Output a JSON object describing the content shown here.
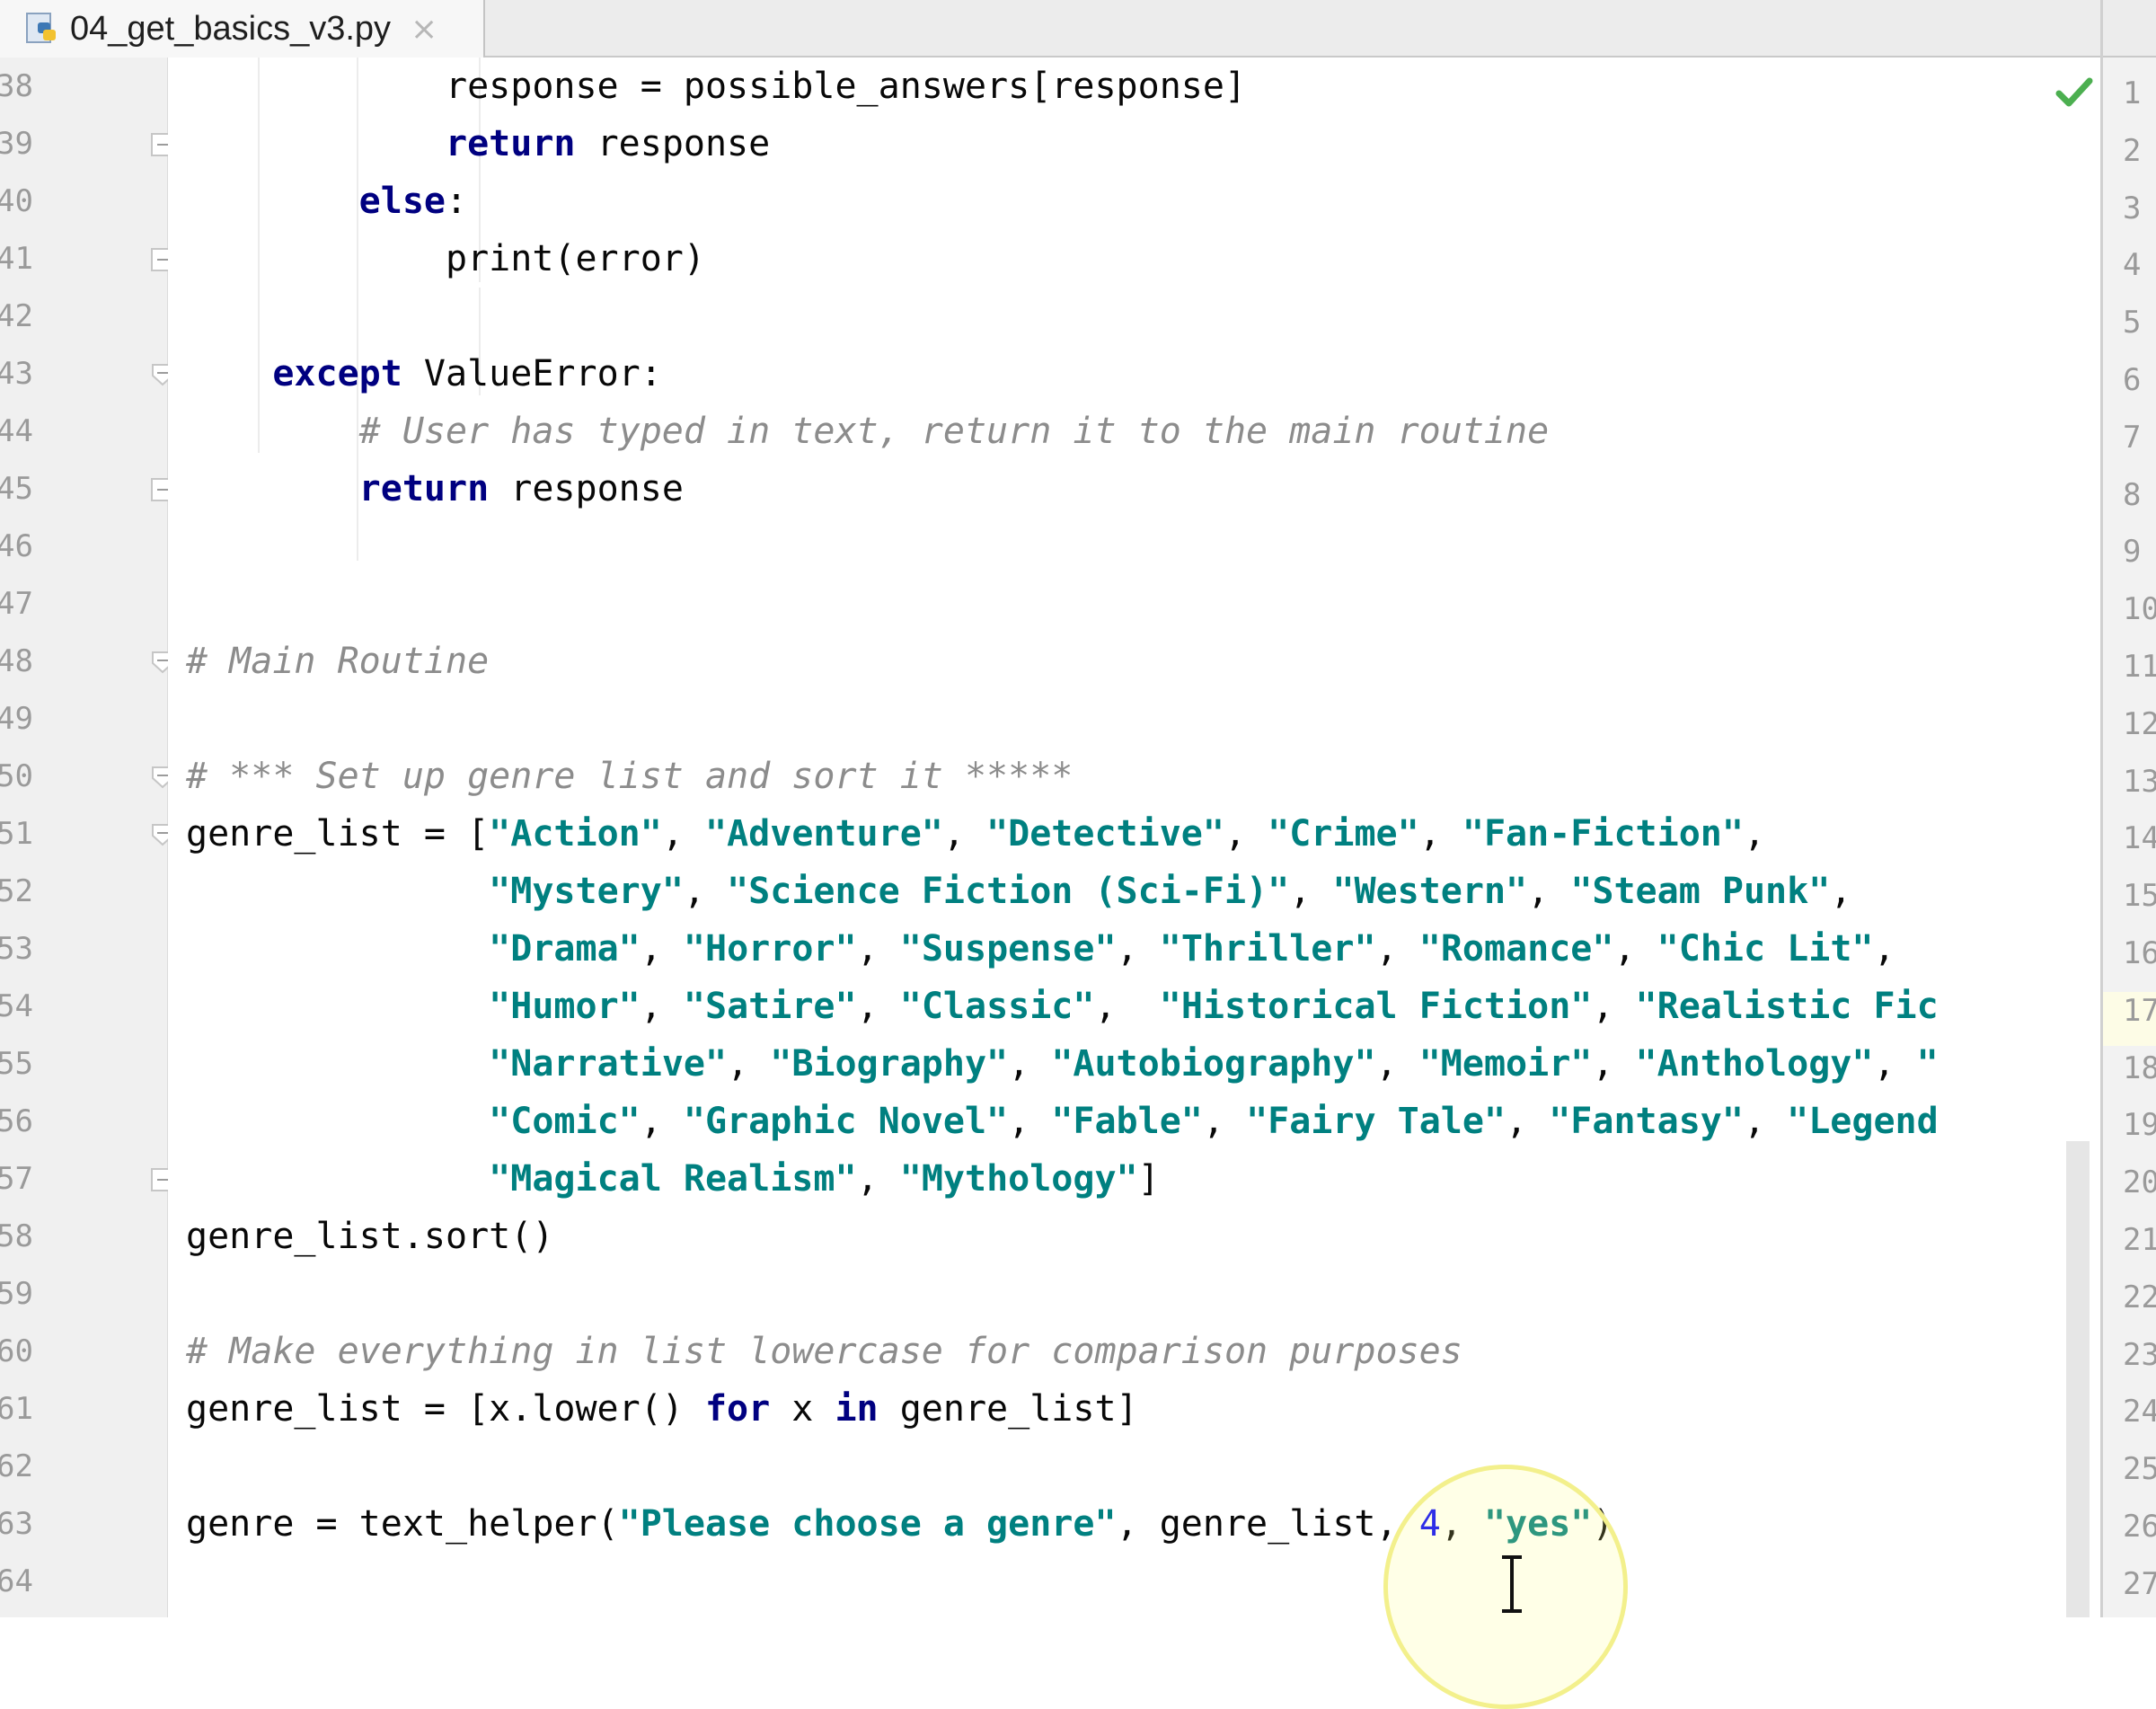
{
  "tab": {
    "filename": "04_get_basics_v3.py",
    "close_glyph": "×",
    "icon": "python-file-icon"
  },
  "status": {
    "inspection_icon": "check-icon",
    "inspection_color": "#4caf50"
  },
  "colors": {
    "keyword": "#000080",
    "string": "#008080",
    "comment": "#8c8c8c",
    "number": "#0000ff",
    "plain": "#080808"
  },
  "lines": [
    {
      "num": "38",
      "segments": [
        {
          "t": "            response = possible_answers[response]",
          "k": "plain"
        }
      ]
    },
    {
      "num": "39",
      "segments": [
        {
          "t": "            ",
          "k": "plain"
        },
        {
          "t": "return",
          "k": "kw"
        },
        {
          "t": " response",
          "k": "plain"
        }
      ]
    },
    {
      "num": "40",
      "segments": [
        {
          "t": "        ",
          "k": "plain"
        },
        {
          "t": "else",
          "k": "kw"
        },
        {
          "t": ":",
          "k": "plain"
        }
      ]
    },
    {
      "num": "41",
      "segments": [
        {
          "t": "            print(error)",
          "k": "plain"
        }
      ]
    },
    {
      "num": "42",
      "segments": []
    },
    {
      "num": "43",
      "segments": [
        {
          "t": "    ",
          "k": "plain"
        },
        {
          "t": "except",
          "k": "kw"
        },
        {
          "t": " ValueError:",
          "k": "plain"
        }
      ]
    },
    {
      "num": "44",
      "segments": [
        {
          "t": "        ",
          "k": "plain"
        },
        {
          "t": "# User has typed in text, return it to the main routine",
          "k": "cm"
        }
      ]
    },
    {
      "num": "45",
      "segments": [
        {
          "t": "        ",
          "k": "plain"
        },
        {
          "t": "return",
          "k": "kw"
        },
        {
          "t": " response",
          "k": "plain"
        }
      ]
    },
    {
      "num": "46",
      "segments": []
    },
    {
      "num": "47",
      "segments": []
    },
    {
      "num": "48",
      "segments": [
        {
          "t": "# Main Routine",
          "k": "cm"
        }
      ]
    },
    {
      "num": "49",
      "segments": []
    },
    {
      "num": "50",
      "segments": [
        {
          "t": "# *** Set up genre list and sort it *****",
          "k": "cm"
        }
      ]
    },
    {
      "num": "51",
      "segments": [
        {
          "t": "genre_list = [",
          "k": "plain"
        },
        {
          "t": "\"Action\"",
          "k": "str"
        },
        {
          "t": ", ",
          "k": "plain"
        },
        {
          "t": "\"Adventure\"",
          "k": "str"
        },
        {
          "t": ", ",
          "k": "plain"
        },
        {
          "t": "\"Detective\"",
          "k": "str"
        },
        {
          "t": ", ",
          "k": "plain"
        },
        {
          "t": "\"Crime\"",
          "k": "str"
        },
        {
          "t": ", ",
          "k": "plain"
        },
        {
          "t": "\"Fan-Fiction\"",
          "k": "str"
        },
        {
          "t": ",",
          "k": "plain"
        }
      ]
    },
    {
      "num": "52",
      "segments": [
        {
          "t": "              ",
          "k": "plain"
        },
        {
          "t": "\"Mystery\"",
          "k": "str"
        },
        {
          "t": ", ",
          "k": "plain"
        },
        {
          "t": "\"Science Fiction (Sci-Fi)\"",
          "k": "str"
        },
        {
          "t": ", ",
          "k": "plain"
        },
        {
          "t": "\"Western\"",
          "k": "str"
        },
        {
          "t": ", ",
          "k": "plain"
        },
        {
          "t": "\"Steam Punk\"",
          "k": "str"
        },
        {
          "t": ",",
          "k": "plain"
        }
      ]
    },
    {
      "num": "53",
      "segments": [
        {
          "t": "              ",
          "k": "plain"
        },
        {
          "t": "\"Drama\"",
          "k": "str"
        },
        {
          "t": ", ",
          "k": "plain"
        },
        {
          "t": "\"Horror\"",
          "k": "str"
        },
        {
          "t": ", ",
          "k": "plain"
        },
        {
          "t": "\"Suspense\"",
          "k": "str"
        },
        {
          "t": ", ",
          "k": "plain"
        },
        {
          "t": "\"Thriller\"",
          "k": "str"
        },
        {
          "t": ", ",
          "k": "plain"
        },
        {
          "t": "\"Romance\"",
          "k": "str"
        },
        {
          "t": ", ",
          "k": "plain"
        },
        {
          "t": "\"Chic Lit\"",
          "k": "str"
        },
        {
          "t": ",",
          "k": "plain"
        }
      ]
    },
    {
      "num": "54",
      "segments": [
        {
          "t": "              ",
          "k": "plain"
        },
        {
          "t": "\"Humor\"",
          "k": "str"
        },
        {
          "t": ", ",
          "k": "plain"
        },
        {
          "t": "\"Satire\"",
          "k": "str"
        },
        {
          "t": ", ",
          "k": "plain"
        },
        {
          "t": "\"Classic\"",
          "k": "str"
        },
        {
          "t": ",  ",
          "k": "plain"
        },
        {
          "t": "\"Historical Fiction\"",
          "k": "str"
        },
        {
          "t": ", ",
          "k": "plain"
        },
        {
          "t": "\"Realistic Fic",
          "k": "str"
        }
      ]
    },
    {
      "num": "55",
      "segments": [
        {
          "t": "              ",
          "k": "plain"
        },
        {
          "t": "\"Narrative\"",
          "k": "str"
        },
        {
          "t": ", ",
          "k": "plain"
        },
        {
          "t": "\"Biography\"",
          "k": "str"
        },
        {
          "t": ", ",
          "k": "plain"
        },
        {
          "t": "\"Autobiography\"",
          "k": "str"
        },
        {
          "t": ", ",
          "k": "plain"
        },
        {
          "t": "\"Memoir\"",
          "k": "str"
        },
        {
          "t": ", ",
          "k": "plain"
        },
        {
          "t": "\"Anthology\"",
          "k": "str"
        },
        {
          "t": ", ",
          "k": "plain"
        },
        {
          "t": "\"",
          "k": "str"
        }
      ]
    },
    {
      "num": "56",
      "segments": [
        {
          "t": "              ",
          "k": "plain"
        },
        {
          "t": "\"Comic\"",
          "k": "str"
        },
        {
          "t": ", ",
          "k": "plain"
        },
        {
          "t": "\"Graphic Novel\"",
          "k": "str"
        },
        {
          "t": ", ",
          "k": "plain"
        },
        {
          "t": "\"Fable\"",
          "k": "str"
        },
        {
          "t": ", ",
          "k": "plain"
        },
        {
          "t": "\"Fairy Tale\"",
          "k": "str"
        },
        {
          "t": ", ",
          "k": "plain"
        },
        {
          "t": "\"Fantasy\"",
          "k": "str"
        },
        {
          "t": ", ",
          "k": "plain"
        },
        {
          "t": "\"Legend",
          "k": "str"
        }
      ]
    },
    {
      "num": "57",
      "segments": [
        {
          "t": "              ",
          "k": "plain"
        },
        {
          "t": "\"Magical Realism\"",
          "k": "str"
        },
        {
          "t": ", ",
          "k": "plain"
        },
        {
          "t": "\"Mythology\"",
          "k": "str"
        },
        {
          "t": "]",
          "k": "plain"
        }
      ]
    },
    {
      "num": "58",
      "segments": [
        {
          "t": "genre_list.sort()",
          "k": "plain"
        }
      ]
    },
    {
      "num": "59",
      "segments": []
    },
    {
      "num": "60",
      "segments": [
        {
          "t": "# Make everything in list lowercase for comparison purposes",
          "k": "cm"
        }
      ]
    },
    {
      "num": "61",
      "segments": [
        {
          "t": "genre_list = [x.lower() ",
          "k": "plain"
        },
        {
          "t": "for",
          "k": "kw"
        },
        {
          "t": " x ",
          "k": "plain"
        },
        {
          "t": "in",
          "k": "kw"
        },
        {
          "t": " genre_list]",
          "k": "plain"
        }
      ]
    },
    {
      "num": "62",
      "segments": []
    },
    {
      "num": "63",
      "segments": [
        {
          "t": "genre = text_helper(",
          "k": "plain"
        },
        {
          "t": "\"Please choose a genre\"",
          "k": "str"
        },
        {
          "t": ", genre_list, ",
          "k": "plain"
        },
        {
          "t": "4",
          "k": "num"
        },
        {
          "t": ", ",
          "k": "plain"
        },
        {
          "t": "\"yes\"",
          "k": "str"
        },
        {
          "t": ")",
          "k": "plain"
        }
      ]
    },
    {
      "num": "64",
      "segments": []
    }
  ],
  "right_panel": {
    "numbers": [
      "1",
      "2",
      "3",
      "4",
      "5",
      "6",
      "7",
      "8",
      "9",
      "10",
      "11",
      "12",
      "13",
      "14",
      "15",
      "16",
      "17",
      "18",
      "19",
      "20",
      "21",
      "22",
      "23",
      "24",
      "25",
      "26",
      "27"
    ]
  }
}
